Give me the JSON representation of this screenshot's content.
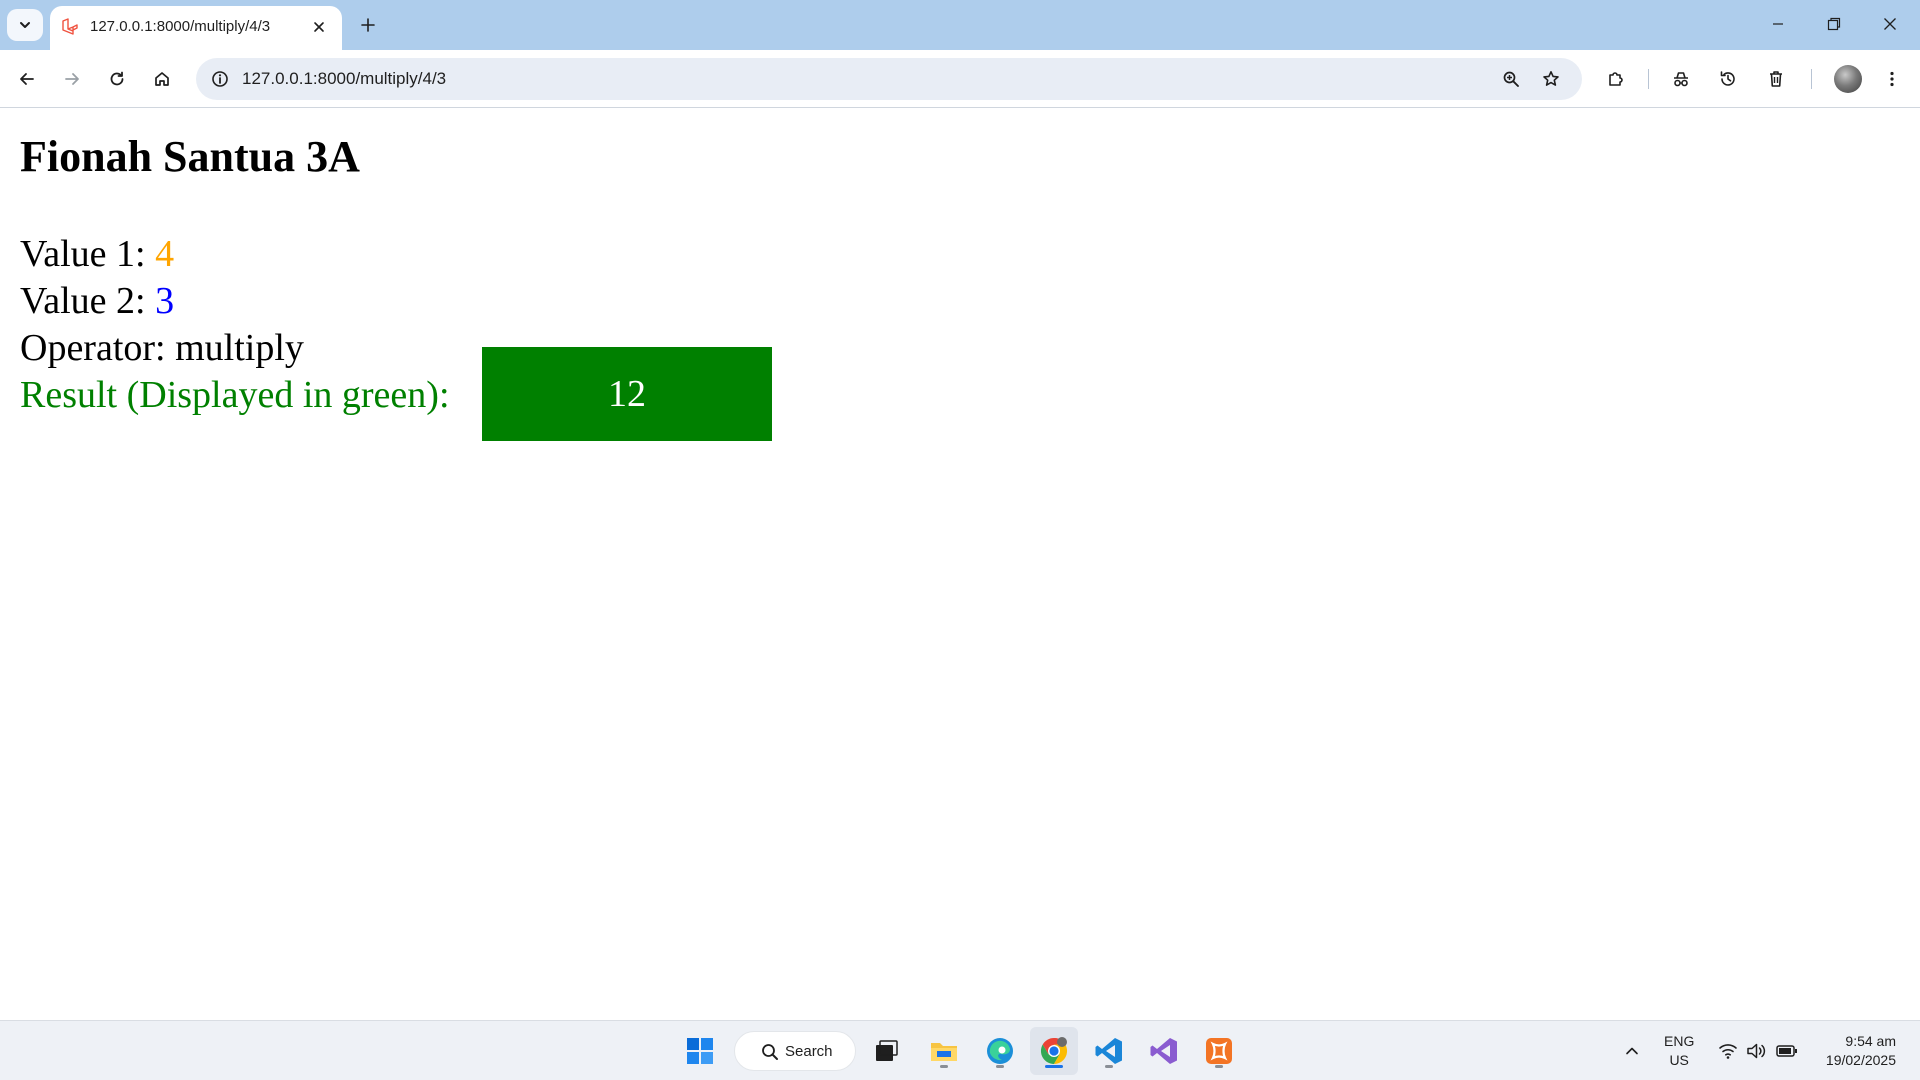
{
  "browser": {
    "tab": {
      "title": "127.0.0.1:8000/multiply/4/3"
    },
    "address_bar": {
      "url": "127.0.0.1:8000/multiply/4/3"
    },
    "accent_color": "#aecdec"
  },
  "page": {
    "title": "Fionah Santua 3A",
    "value1": {
      "label": "Value 1:",
      "value": "4",
      "color": "#ffa500"
    },
    "value2": {
      "label": "Value 2:",
      "value": "3",
      "color": "#0000ff"
    },
    "operator": {
      "label": "Operator:",
      "value": "multiply"
    },
    "result": {
      "label": "Result (Displayed in green):",
      "value": "12",
      "color": "#008000"
    }
  },
  "taskbar": {
    "search_label": "Search",
    "language": {
      "line1": "ENG",
      "line2": "US"
    },
    "time": "9:54 am",
    "date": "19/02/2025"
  }
}
